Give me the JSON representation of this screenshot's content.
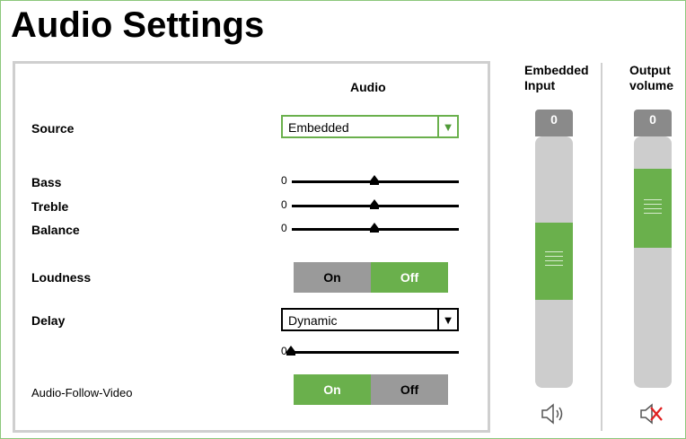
{
  "page": {
    "title": "Audio Settings"
  },
  "panel": {
    "column_header": "Audio",
    "source": {
      "label": "Source",
      "value": "Embedded"
    },
    "bass": {
      "label": "Bass",
      "value": "0"
    },
    "treble": {
      "label": "Treble",
      "value": "0"
    },
    "balance": {
      "label": "Balance",
      "value": "0"
    },
    "loudness": {
      "label": "Loudness",
      "on_label": "On",
      "off_label": "Off",
      "selected": "Off"
    },
    "delay": {
      "label": "Delay",
      "value": "Dynamic",
      "slider_value": "0"
    },
    "afv": {
      "label": "Audio-Follow-Video",
      "on_label": "On",
      "off_label": "Off",
      "selected": "On"
    }
  },
  "faders": {
    "embedded": {
      "header_line1": "Embedded",
      "header_line2": "Input",
      "value": "0",
      "icon": "speaker-icon"
    },
    "output": {
      "header_line1": "Output",
      "header_line2": "volume",
      "value": "0",
      "icon": "speaker-muted-icon"
    }
  },
  "colors": {
    "accent": "#6ab04c",
    "inactive": "#9a9a9a",
    "mute": "#e02020"
  }
}
